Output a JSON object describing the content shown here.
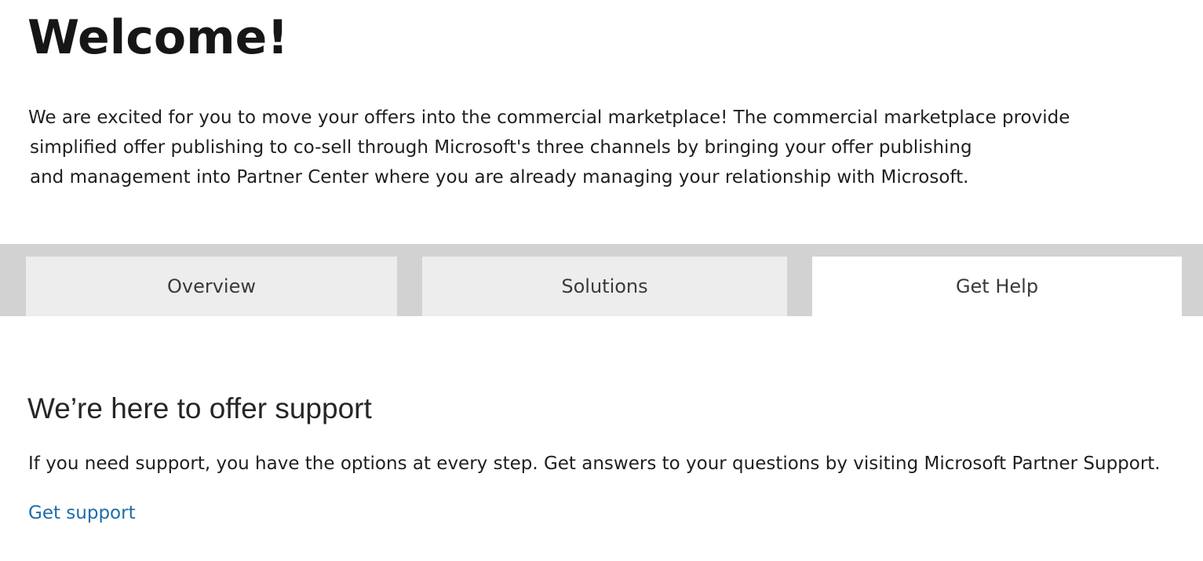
{
  "header": {
    "title": "Welcome!"
  },
  "intro": {
    "line1": "We are excited for you to move your offers into the commercial marketplace! The commercial marketplace provides",
    "line2": "simplified offer publishing to co-sell through Microsoft's three channels by bringing your offer publishing",
    "line3": "and management into Partner Center where you are already managing your relationship with Microsoft."
  },
  "tabs": [
    {
      "label": "Overview",
      "selected": false
    },
    {
      "label": "Solutions",
      "selected": false
    },
    {
      "label": "Get Help",
      "selected": true
    }
  ],
  "get_help": {
    "heading": "We’re here to offer support",
    "body": "If you need support, you have the options at every step. Get answers to your questions by visiting Microsoft Partner Support.",
    "link_label": "Get support"
  },
  "colors": {
    "tab_strip": "#d2d2d2",
    "tab_inactive": "#ededed",
    "tab_active": "#ffffff",
    "link": "#1f6ca8"
  }
}
